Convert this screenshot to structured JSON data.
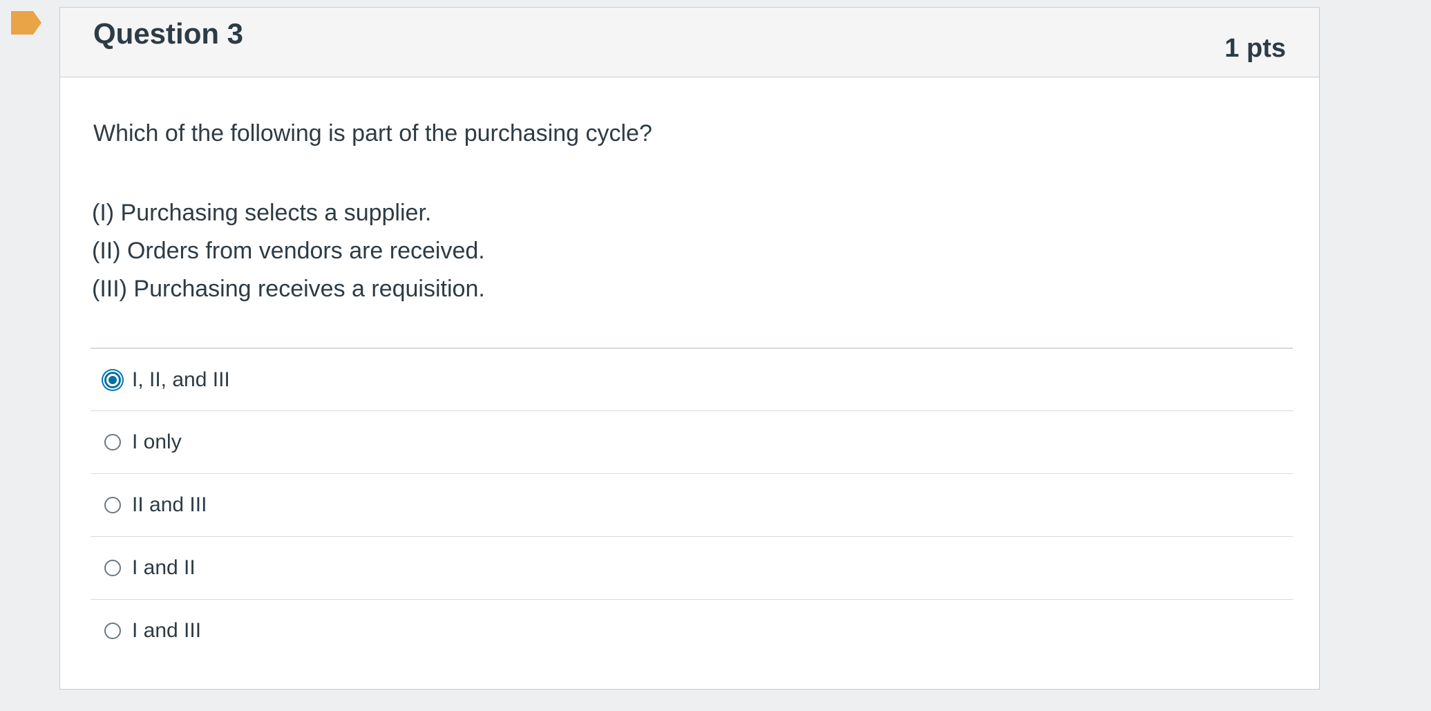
{
  "question": {
    "title": "Question 3",
    "points": "1 pts",
    "text": "Which of the following is part of the purchasing cycle?",
    "statements": [
      "(I) Purchasing selects a supplier.",
      "(II) Orders from vendors are received.",
      "(III) Purchasing receives a requisition."
    ],
    "answers": [
      {
        "label": "I, II, and III",
        "selected": true
      },
      {
        "label": "I only",
        "selected": false
      },
      {
        "label": "II and III",
        "selected": false
      },
      {
        "label": "I and II",
        "selected": false
      },
      {
        "label": "I and III",
        "selected": false
      }
    ]
  },
  "colors": {
    "flag": "#e8a447",
    "selected_radio": "#0770a3"
  }
}
